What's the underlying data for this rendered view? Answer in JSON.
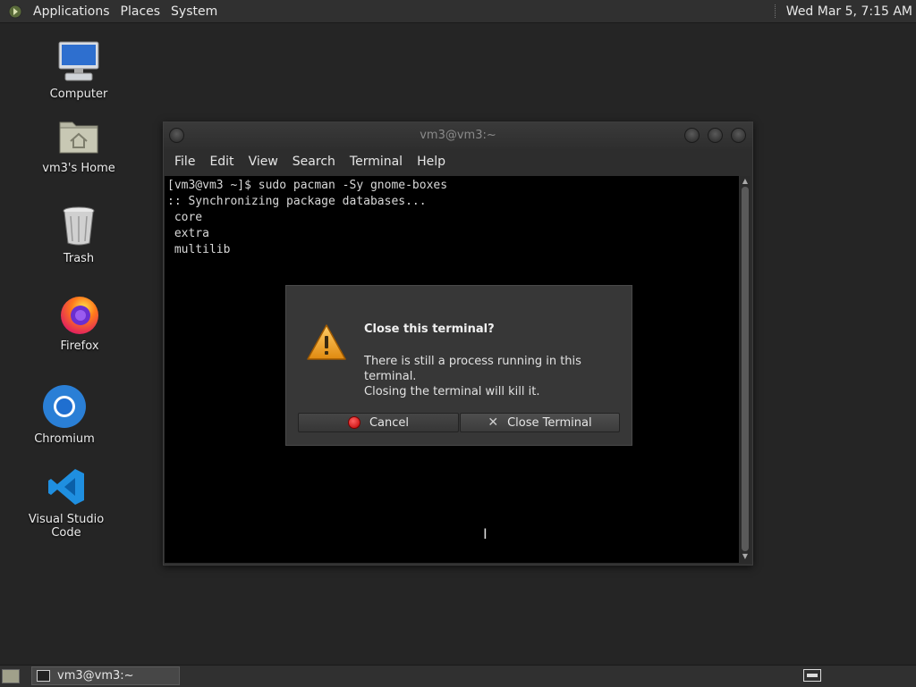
{
  "top_panel": {
    "menus": [
      "Applications",
      "Places",
      "System"
    ],
    "clock": "Wed Mar  5,  7:15 AM"
  },
  "desktop": {
    "icons": [
      {
        "label": "Computer",
        "icon": "computer-icon"
      },
      {
        "label": "vm3's Home",
        "icon": "home-folder-icon"
      },
      {
        "label": "Trash",
        "icon": "trash-icon"
      },
      {
        "label": "Firefox",
        "icon": "firefox-icon"
      },
      {
        "label": "Chromium",
        "icon": "chromium-icon"
      },
      {
        "label": "Visual Studio Code",
        "icon": "vscode-icon"
      }
    ]
  },
  "terminal": {
    "title": "vm3@vm3:~",
    "menu": [
      "File",
      "Edit",
      "View",
      "Search",
      "Terminal",
      "Help"
    ],
    "lines": [
      "[vm3@vm3 ~]$ sudo pacman -Sy gnome-boxes",
      ":: Synchronizing package databases...",
      " core",
      " extra",
      " multilib"
    ]
  },
  "dialog": {
    "title": "Close this terminal?",
    "message_line1": "There is still a process running in this terminal.",
    "message_line2": "Closing the terminal will kill it.",
    "cancel_label": "Cancel",
    "close_label": "Close Terminal"
  },
  "taskbar": {
    "window_label": "vm3@vm3:~"
  },
  "colors": {
    "desktop_bg": "#252525",
    "panel_bg": "#303030",
    "warning": "#f0a020",
    "cancel_dot": "#e02020"
  }
}
